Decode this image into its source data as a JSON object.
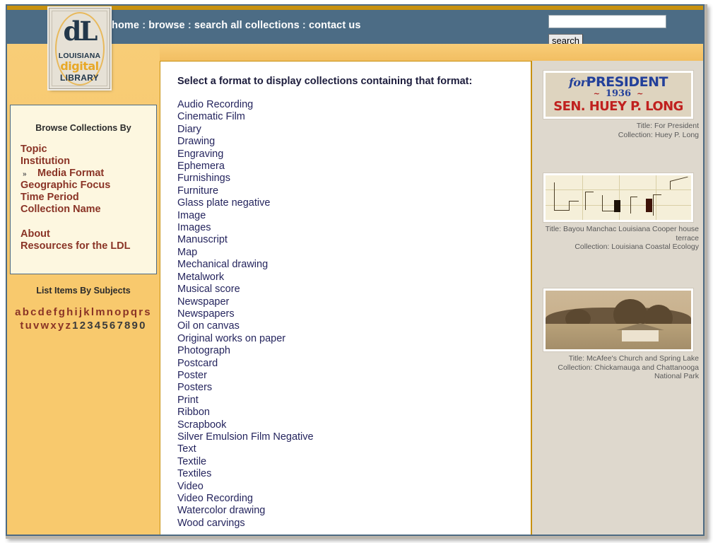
{
  "site": {
    "logo": {
      "monogram": "dL",
      "line1": "LOUISIANA",
      "line2": "digital",
      "line3": "LIBRARY"
    },
    "colors": {
      "navbar": "#4c6c85",
      "amber": "#f8cd77",
      "gold_rule": "#c8910f",
      "sidebar_link": "#8a3426",
      "content_link": "#25255e",
      "right_panel_bg": "#ded8cd"
    }
  },
  "nav": {
    "items": [
      "home",
      "browse",
      "search all collections",
      "contact us"
    ],
    "separator": ":"
  },
  "search": {
    "value": "",
    "placeholder": "",
    "button_label": "search"
  },
  "sidebar": {
    "browse_title": "Browse Collections By",
    "browse_items": [
      {
        "label": "Topic",
        "current": false
      },
      {
        "label": "Institution",
        "current": false
      },
      {
        "label": "Media Format",
        "current": true
      },
      {
        "label": "Geographic Focus",
        "current": false
      },
      {
        "label": "Time Period",
        "current": false
      },
      {
        "label": "Collection Name",
        "current": false
      }
    ],
    "current_marker": "»",
    "extra_links": [
      {
        "label": "About"
      },
      {
        "label": "Resources for the LDL"
      }
    ],
    "subjects_title": "List Items By Subjects",
    "alpha_row1": [
      "a",
      "b",
      "c",
      "d",
      "e",
      "f",
      "g",
      "h",
      "i",
      "j",
      "k",
      "l",
      "m",
      "n",
      "o",
      "p",
      "q",
      "r",
      "s"
    ],
    "alpha_row2": [
      "t",
      "u",
      "v",
      "w",
      "x",
      "y",
      "z"
    ],
    "digits_row2": [
      "1",
      "2",
      "3",
      "4",
      "5",
      "6",
      "7",
      "8",
      "9",
      "0"
    ]
  },
  "main": {
    "heading": "Select a format to display collections containing that format:",
    "formats": [
      "Audio Recording",
      "Cinematic Film",
      "Diary",
      "Drawing",
      "Engraving",
      "Ephemera",
      "Furnishings",
      "Furniture",
      "Glass plate negative",
      "Image",
      "Images",
      "Manuscript",
      "Map",
      "Mechanical drawing",
      "Metalwork",
      "Musical score",
      "Newspaper",
      "Newspapers",
      "Oil on canvas",
      "Original works on paper",
      "Photograph",
      "Postcard",
      "Poster",
      "Posters",
      "Print",
      "Ribbon",
      "Scrapbook",
      "Silver Emulsion Film Negative",
      "Text",
      "Textile",
      "Textiles",
      "Video",
      "Video Recording",
      "Watercolor drawing",
      "Wood carvings"
    ]
  },
  "features": [
    {
      "artwork": "campaign-poster",
      "poster_line1_small": "for",
      "poster_line1_big": "PRESIDENT",
      "poster_line2": "1936",
      "poster_line3": "SEN. HUEY P. LONG",
      "caption": "Title: For President\nCollection: Huey P. Long",
      "title_label": "Title: For President",
      "collection_label": "Collection: Huey P. Long"
    },
    {
      "artwork": "geologic-cross-section",
      "caption": "Title: Bayou Manchac Louisiana Cooper house terrace\nCollection: Louisiana Coastal Ecology",
      "title_label": "Title: Bayou Manchac Louisiana Cooper house terrace",
      "collection_label": "Collection: Louisiana Coastal Ecology"
    },
    {
      "artwork": "sepia-landscape-photo",
      "caption": "Title: McAfee's Church and Spring Lake\nCollection: Chickamauga and Chattanooga National Park",
      "title_label": "Title: McAfee's Church and Spring Lake",
      "collection_label": "Collection: Chickamauga and Chattanooga National Park"
    }
  ]
}
